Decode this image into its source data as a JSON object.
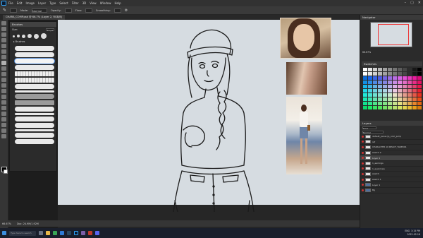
{
  "document_tab": "CHARA_COMP.psd @ 66.7% (Layer 2, RGB/8)",
  "menu": [
    "File",
    "Edit",
    "Image",
    "Layer",
    "Type",
    "Select",
    "Filter",
    "3D",
    "View",
    "Window",
    "Help"
  ],
  "options_bar": [
    "Mode:",
    "Normal",
    "Opacity:",
    "Flow:",
    "Smoothing:"
  ],
  "brushes_panel": {
    "title": "Brushes",
    "size_label": "Size:",
    "size_value": "15 px",
    "folder_label": "Brushes"
  },
  "navigator": {
    "title": "Navigator",
    "zoom": "66.67%"
  },
  "swatches": {
    "title": "Swatches"
  },
  "layers_panel": {
    "title": "Layers",
    "kind": "Kind",
    "blend_mode": "Normal",
    "layers": [
      {
        "name": "default_pene (s)_cool_jump",
        "active": false,
        "blue": false
      },
      {
        "name": "ref",
        "active": false,
        "blue": false
      },
      {
        "name": "CHARACTER 10 REACT_TAKE001",
        "active": false,
        "blue": false
      },
      {
        "name": "sketch 2",
        "active": false,
        "blue": false
      },
      {
        "name": "Layer 2",
        "active": true,
        "blue": false
      },
      {
        "name": "1_earrings",
        "active": false,
        "blue": false
      },
      {
        "name": "1_eyebrows",
        "active": false,
        "blue": false
      },
      {
        "name": "sketch",
        "active": false,
        "blue": false
      },
      {
        "name": "sketch 1",
        "active": false,
        "blue": false
      },
      {
        "name": "Layer 1",
        "active": false,
        "blue": true
      },
      {
        "name": "Bg",
        "active": false,
        "blue": true
      }
    ]
  },
  "status_bar": {
    "zoom": "66.67%",
    "doc": "Doc: 24.9M/1.92M"
  },
  "taskbar": {
    "search_placeholder": "Type here to search",
    "time": "3:15 PM",
    "date": "2022-02-16",
    "lang": "ENG"
  },
  "colors": {
    "accent": "#31a8ff",
    "canvas": "#d6dce1",
    "panel": "#2b2b2b"
  }
}
